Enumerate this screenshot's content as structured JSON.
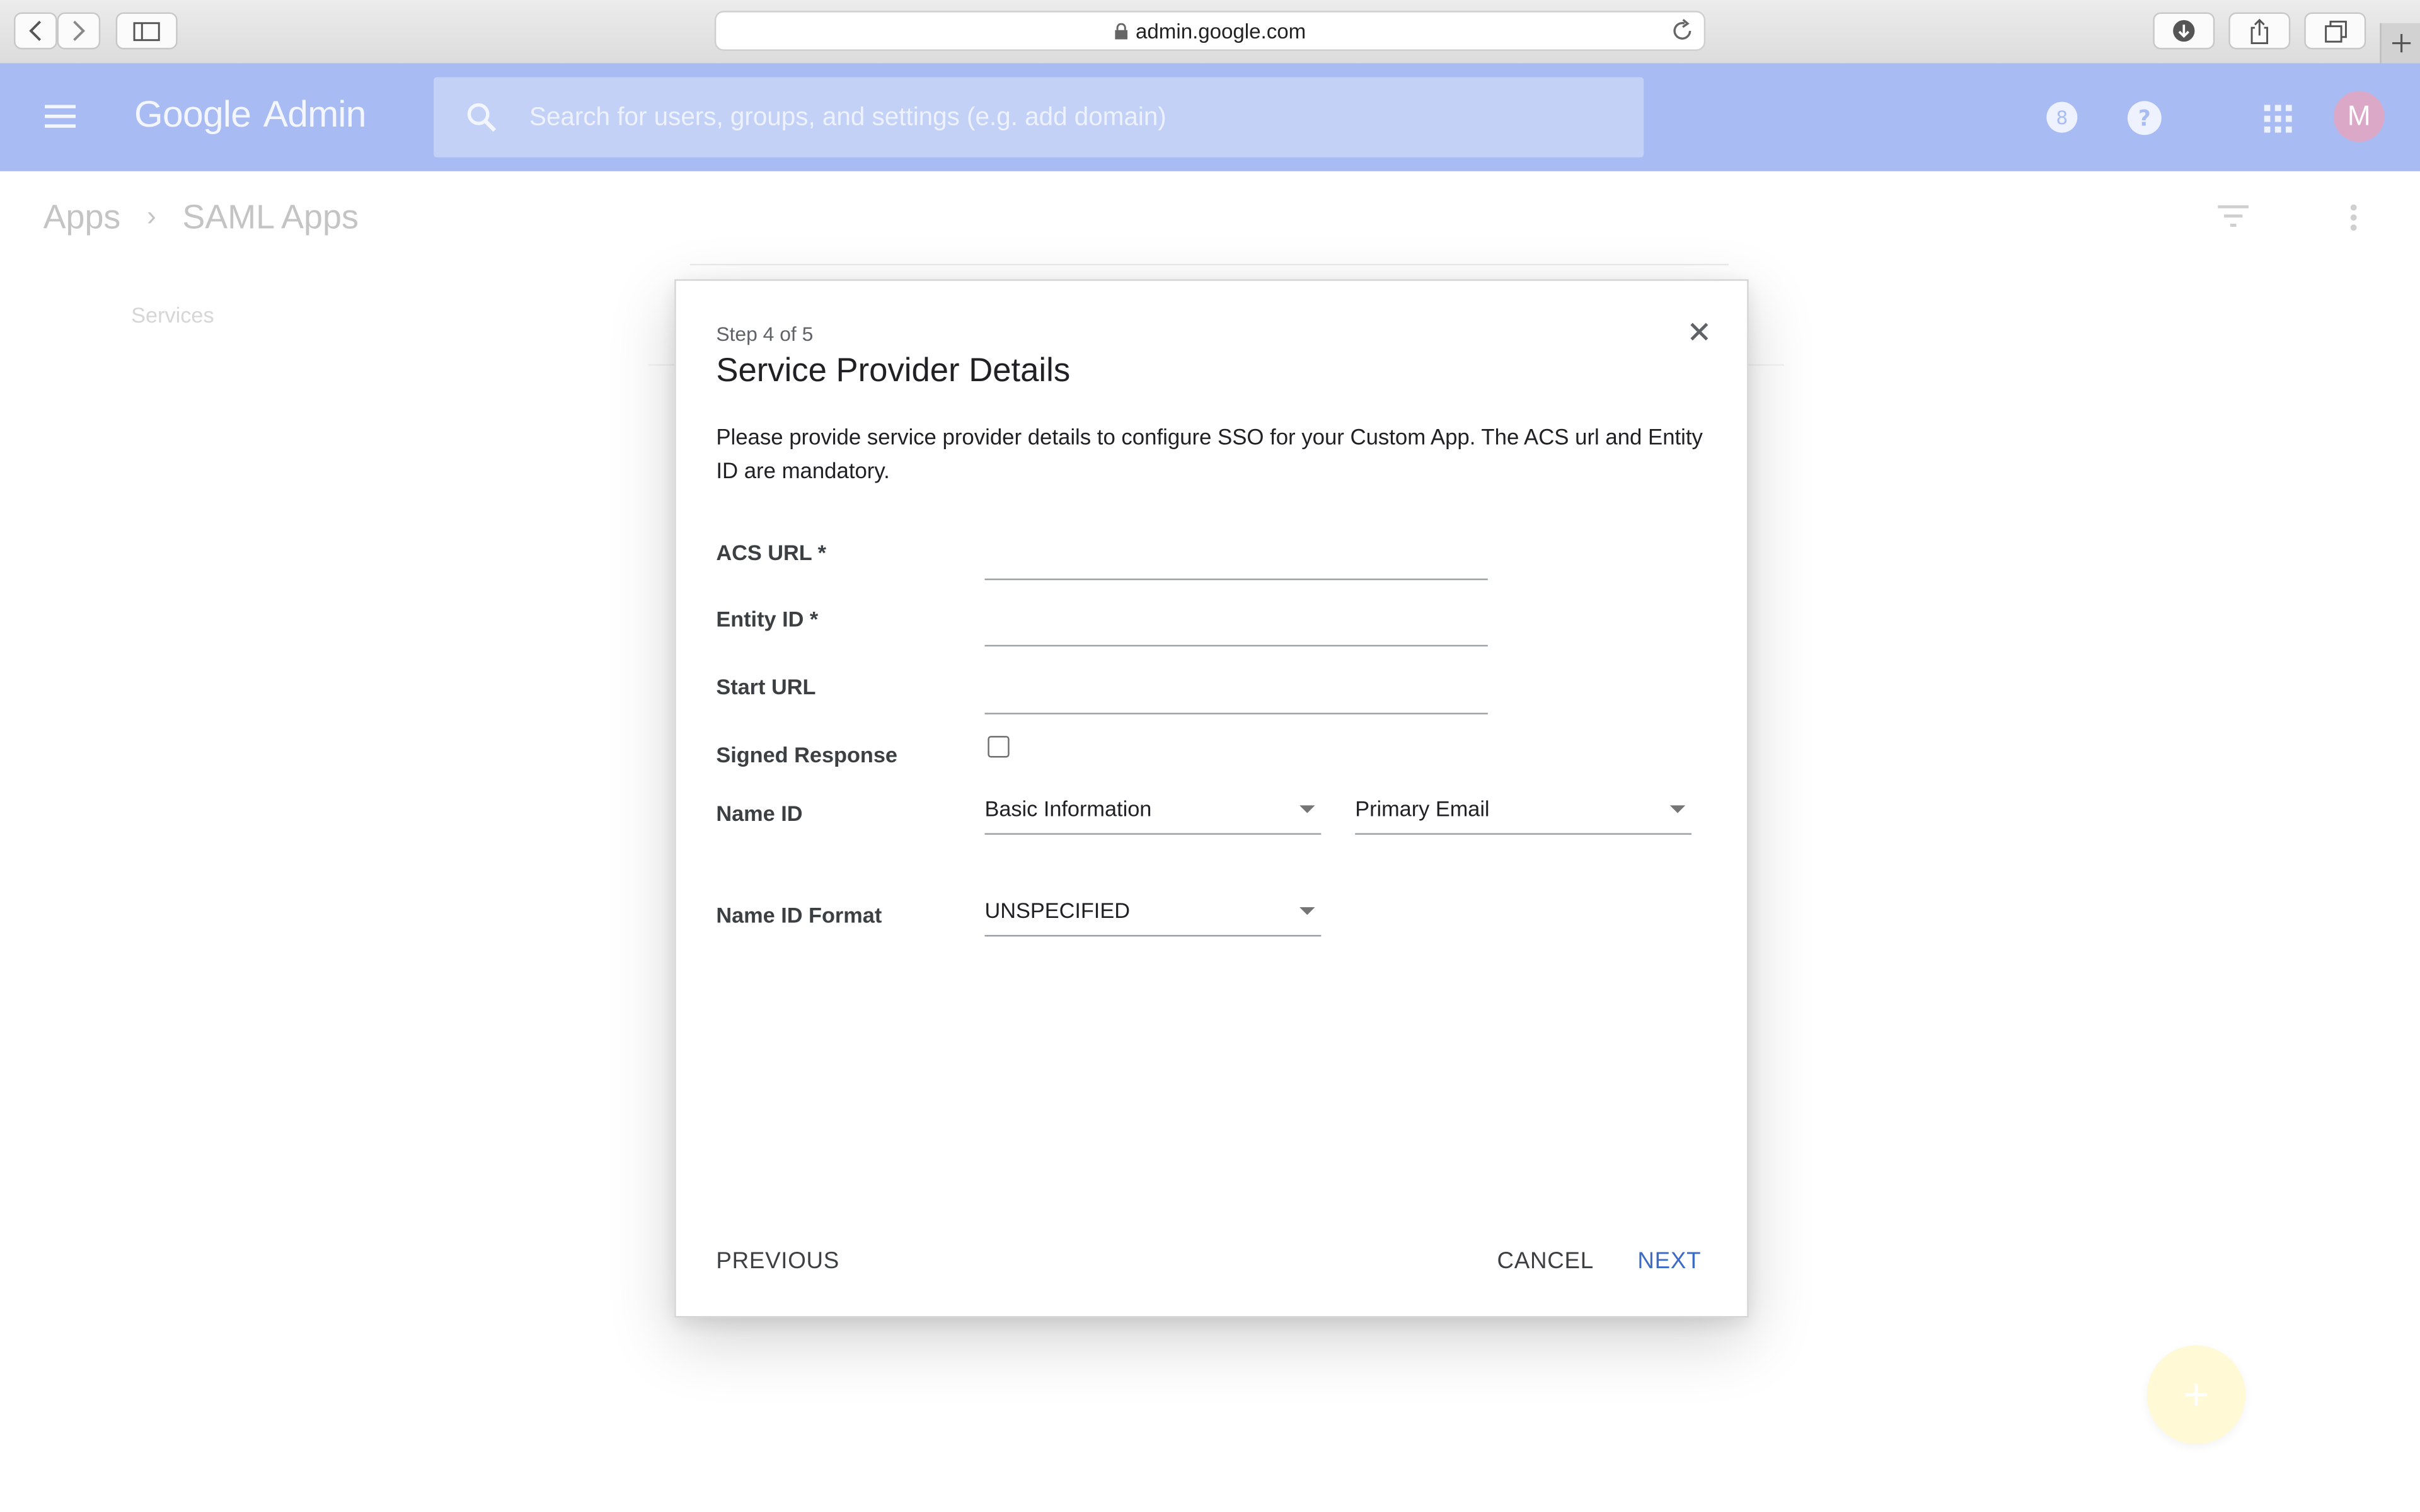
{
  "browser": {
    "url": "admin.google.com"
  },
  "header": {
    "logo_google": "Google",
    "logo_admin": "Admin",
    "search_placeholder": "Search for users, groups, and settings (e.g. add domain)",
    "avatar_letter": "M"
  },
  "page": {
    "breadcrumb": [
      "Apps",
      "SAML Apps"
    ],
    "services_label": "Services"
  },
  "dialog": {
    "step": "Step 4 of 5",
    "title": "Service Provider Details",
    "description": "Please provide service provider details to configure SSO for your Custom App. The ACS url and Entity ID are mandatory.",
    "fields": {
      "acs_url": {
        "label": "ACS URL *",
        "value": ""
      },
      "entity_id": {
        "label": "Entity ID *",
        "value": ""
      },
      "start_url": {
        "label": "Start URL",
        "value": ""
      },
      "signed_response": {
        "label": "Signed Response",
        "checked": false
      },
      "name_id": {
        "label": "Name ID",
        "category": "Basic Information",
        "attribute": "Primary Email"
      },
      "name_id_format": {
        "label": "Name ID Format",
        "value": "UNSPECIFIED"
      }
    },
    "buttons": {
      "previous": "PREVIOUS",
      "cancel": "CANCEL",
      "next": "NEXT"
    }
  },
  "colors": {
    "header_bg": "#a8bcf3",
    "search_bg": "#c3d1f7",
    "next_button": "#3c6bc7",
    "avatar_bg": "#dba8c8",
    "fab_bg": "#fff9d6"
  },
  "icons": {
    "back": "chevron-left-icon",
    "forward": "chevron-right-icon",
    "sidebar": "sidebar-icon",
    "lock": "lock-icon",
    "reload": "reload-icon",
    "download": "download-icon",
    "share": "share-icon",
    "tabs": "tabs-icon",
    "new_tab": "plus-icon",
    "menu": "hamburger-icon",
    "search": "search-icon",
    "timer": "timer-icon",
    "help": "help-icon",
    "apps": "apps-grid-icon",
    "filter": "filter-icon",
    "more": "more-vert-icon",
    "close": "close-icon",
    "add": "add-icon"
  }
}
